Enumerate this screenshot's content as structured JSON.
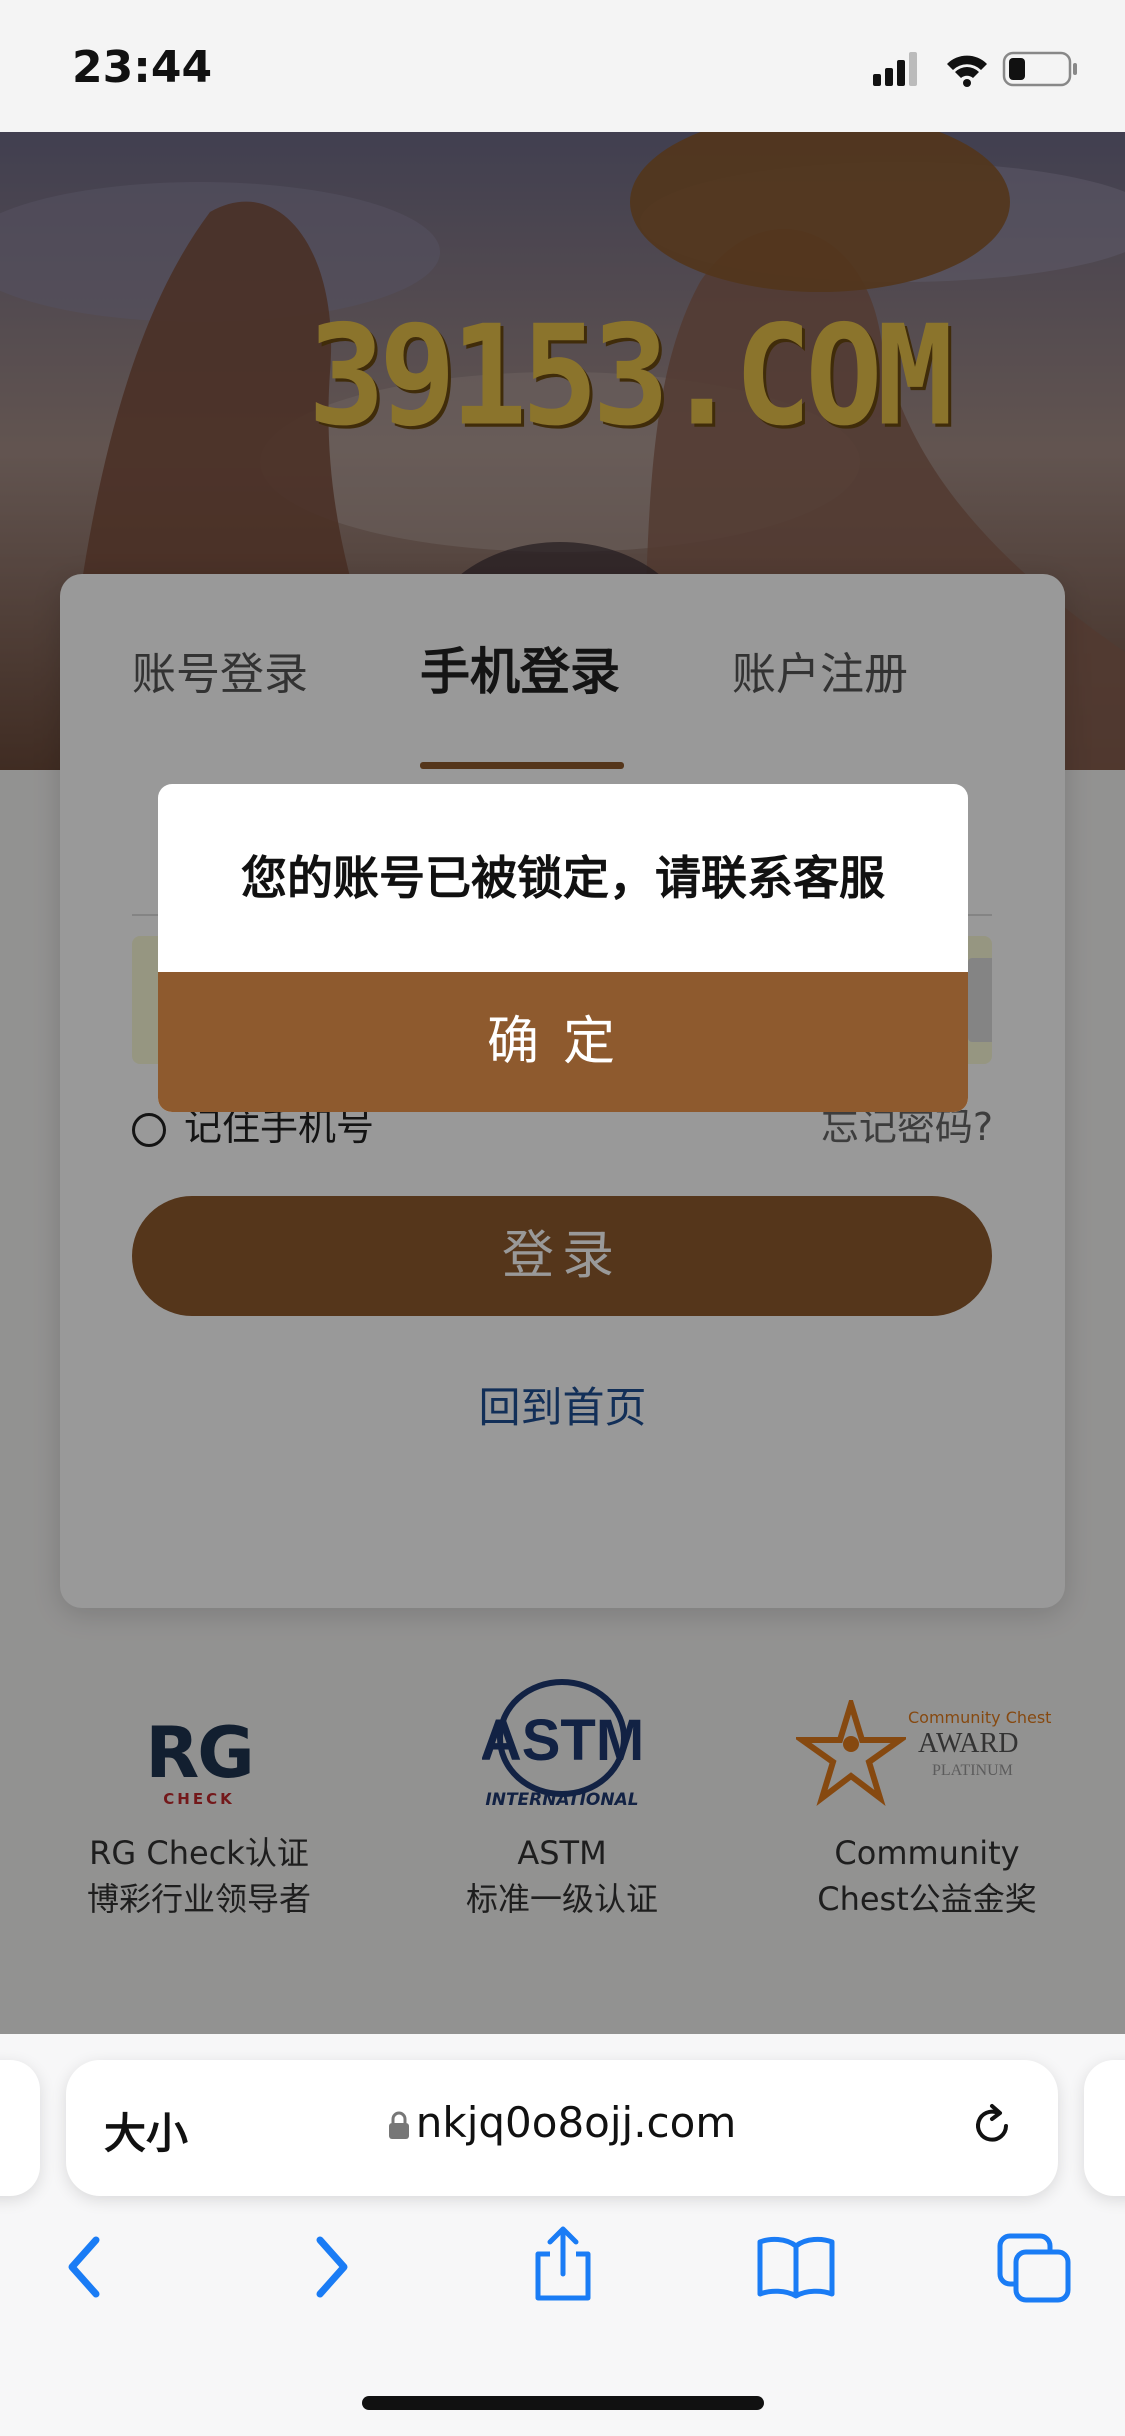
{
  "status_bar": {
    "time": "23:44"
  },
  "banner": {
    "logo_text": "39153.COM"
  },
  "login": {
    "tabs": [
      "账号登录",
      "手机登录",
      "账户注册"
    ],
    "active_tab": 1,
    "remember_label": "记住手机号",
    "forgot_label": "忘记密码?",
    "login_button": "登录",
    "home_link": "回到首页"
  },
  "badges": [
    {
      "logo": "RG",
      "logo_sub": "CHECK",
      "line1": "RG Check认证",
      "line2": "博彩行业领导者"
    },
    {
      "logo": "ASTM",
      "logo_sub": "INTERNATIONAL",
      "line1": "ASTM",
      "line2": "标准一级认证"
    },
    {
      "logo": "Community Chest",
      "logo_sub": "AWARD",
      "logo_sub2": "PLATINUM",
      "line1": "Community",
      "line2": "Chest公益金奖"
    }
  ],
  "dialog": {
    "message": "您的账号已被锁定，请联系客服",
    "confirm": "确定"
  },
  "safari": {
    "text_size_label": "大小",
    "url": "nkjq0o8ojj.com"
  },
  "colors": {
    "accent": "#8e5a2e",
    "link": "#1f4f93",
    "ios_blue": "#1a7cf5"
  }
}
